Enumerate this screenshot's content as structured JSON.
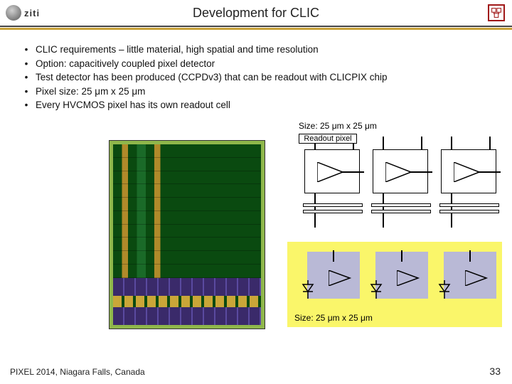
{
  "header": {
    "title": "Development for CLIC",
    "logo_left_text": "ziti"
  },
  "bullets": [
    "CLIC requirements – little material, high spatial and time resolution",
    "Option: capacitively coupled pixel detector",
    "Test detector has been produced (CCPDv3) that can be readout with CLICPIX chip",
    "Pixel size: 25 μm x 25 μm",
    "Every HVCMOS pixel has its own readout cell"
  ],
  "diagram": {
    "size_label_upper": "Size: 25 μm x 25 μm",
    "readout_label": "Readout pixel",
    "size_label_lower": "Size: 25 μm x 25 μm"
  },
  "footer": {
    "left": "PIXEL 2014, Niagara Falls, Canada",
    "page": "33"
  }
}
